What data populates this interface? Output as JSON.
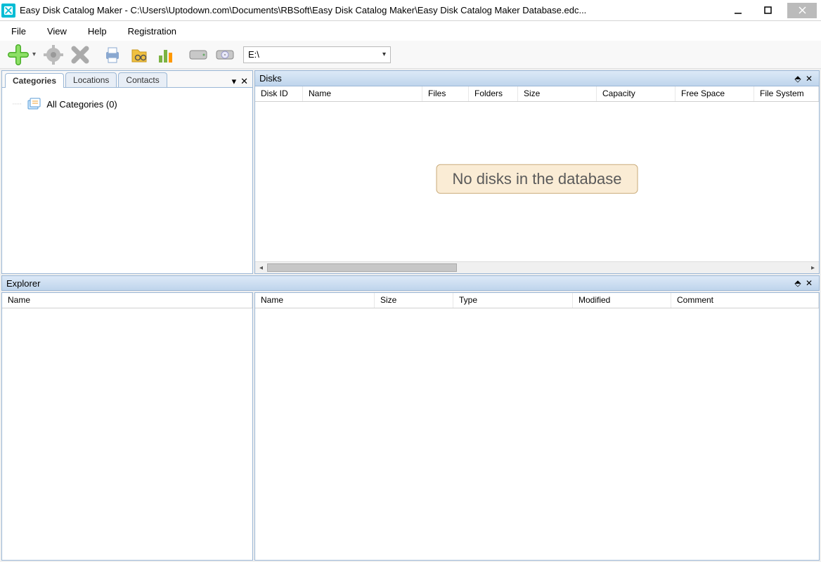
{
  "title": "Easy Disk Catalog Maker - C:\\Users\\Uptodown.com\\Documents\\RBSoft\\Easy Disk Catalog Maker\\Easy Disk Catalog Maker Database.edc...",
  "menu": [
    "File",
    "View",
    "Help",
    "Registration"
  ],
  "toolbar": {
    "drive": "E:\\"
  },
  "tabs": [
    "Categories",
    "Locations",
    "Contacts"
  ],
  "tree": {
    "root_label": "All Categories (0)"
  },
  "disks": {
    "title": "Disks",
    "columns": [
      "Disk ID",
      "Name",
      "Files",
      "Folders",
      "Size",
      "Capacity",
      "Free Space",
      "File System"
    ],
    "empty_message": "No disks in the database"
  },
  "explorer": {
    "title": "Explorer",
    "left_columns": [
      "Name"
    ],
    "right_columns": [
      "Name",
      "Size",
      "Type",
      "Modified",
      "Comment"
    ]
  }
}
